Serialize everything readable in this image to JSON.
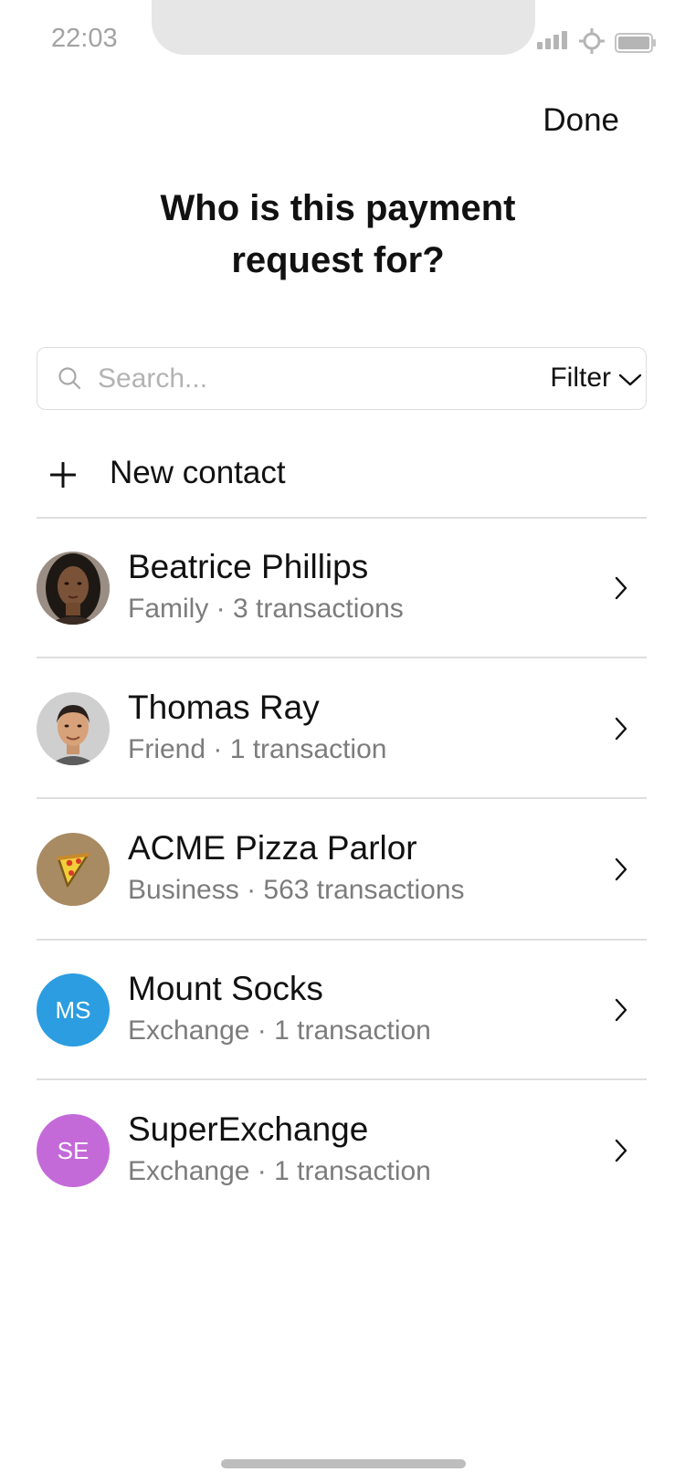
{
  "status": {
    "time": "22:03"
  },
  "header": {
    "done_label": "Done",
    "title_line1": "Who is this payment",
    "title_line2": "request for?"
  },
  "search": {
    "placeholder": "Search...",
    "filter_label": "Filter"
  },
  "new_contact_label": "New contact",
  "contacts": [
    {
      "name": "Beatrice Phillips",
      "meta": "Family · 3 transactions",
      "avatar_type": "photo-woman"
    },
    {
      "name": "Thomas Ray",
      "meta": "Friend · 1 transaction",
      "avatar_type": "photo-man"
    },
    {
      "name": "ACME Pizza Parlor",
      "meta": "Business · 563 transactions",
      "avatar_type": "pizza-icon",
      "avatar_color": "#a88a63"
    },
    {
      "name": "Mount Socks",
      "meta": "Exchange · 1 transaction",
      "initials": "MS",
      "avatar_color": "#2b9de0"
    },
    {
      "name": "SuperExchange",
      "meta": "Exchange · 1 transaction",
      "initials": "SE",
      "avatar_color": "#c46ad8"
    }
  ]
}
